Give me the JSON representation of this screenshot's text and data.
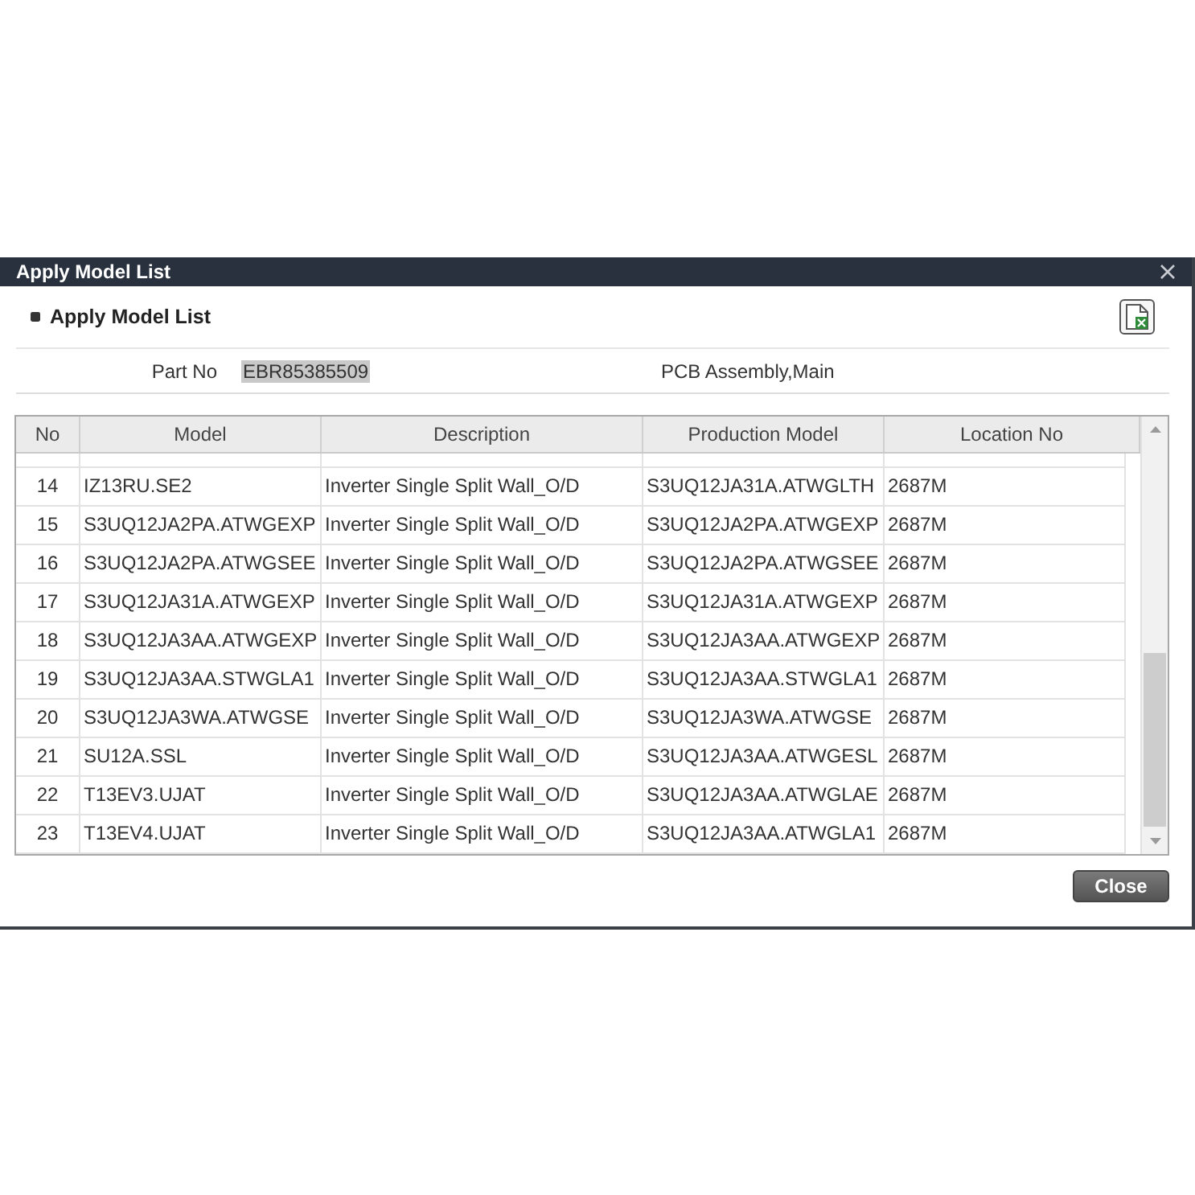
{
  "window": {
    "title": "Apply Model List"
  },
  "section": {
    "title": "Apply Model List"
  },
  "part": {
    "label": "Part No",
    "value": "EBR85385509",
    "description": "PCB Assembly,Main"
  },
  "table": {
    "columns": [
      "No",
      "Model",
      "Description",
      "Production Model",
      "Location No"
    ],
    "rows": [
      {
        "no": "14",
        "model": "IZ13RU.SE2",
        "description": "Inverter Single Split Wall_O/D",
        "production_model": "S3UQ12JA31A.ATWGLTH",
        "location_no": "2687M"
      },
      {
        "no": "15",
        "model": "S3UQ12JA2PA.ATWGEXP",
        "description": "Inverter Single Split Wall_O/D",
        "production_model": "S3UQ12JA2PA.ATWGEXP",
        "location_no": "2687M"
      },
      {
        "no": "16",
        "model": "S3UQ12JA2PA.ATWGSEE",
        "description": "Inverter Single Split Wall_O/D",
        "production_model": "S3UQ12JA2PA.ATWGSEE",
        "location_no": "2687M"
      },
      {
        "no": "17",
        "model": "S3UQ12JA31A.ATWGEXP",
        "description": "Inverter Single Split Wall_O/D",
        "production_model": "S3UQ12JA31A.ATWGEXP",
        "location_no": "2687M"
      },
      {
        "no": "18",
        "model": "S3UQ12JA3AA.ATWGEXP",
        "description": "Inverter Single Split Wall_O/D",
        "production_model": "S3UQ12JA3AA.ATWGEXP",
        "location_no": "2687M"
      },
      {
        "no": "19",
        "model": "S3UQ12JA3AA.STWGLA1",
        "description": "Inverter Single Split Wall_O/D",
        "production_model": "S3UQ12JA3AA.STWGLA1",
        "location_no": "2687M"
      },
      {
        "no": "20",
        "model": "S3UQ12JA3WA.ATWGSE",
        "description": "Inverter Single Split Wall_O/D",
        "production_model": "S3UQ12JA3WA.ATWGSE",
        "location_no": "2687M"
      },
      {
        "no": "21",
        "model": "SU12A.SSL",
        "description": "Inverter Single Split Wall_O/D",
        "production_model": "S3UQ12JA3AA.ATWGESL",
        "location_no": "2687M"
      },
      {
        "no": "22",
        "model": "T13EV3.UJAT",
        "description": "Inverter Single Split Wall_O/D",
        "production_model": "S3UQ12JA3AA.ATWGLAE",
        "location_no": "2687M"
      },
      {
        "no": "23",
        "model": "T13EV4.UJAT",
        "description": "Inverter Single Split Wall_O/D",
        "production_model": "S3UQ12JA3AA.ATWGLA1",
        "location_no": "2687M"
      }
    ]
  },
  "close_button": {
    "label": "Close"
  }
}
